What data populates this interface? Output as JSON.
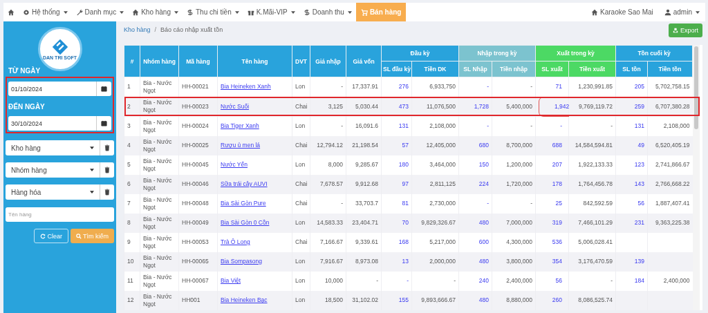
{
  "navbar": {
    "items": [
      {
        "selected": false,
        "caret": false
      },
      {
        "label": "Hệ thống",
        "selected": false,
        "caret": true
      },
      {
        "label": "Danh mục",
        "selected": false,
        "caret": true
      },
      {
        "label": "Kho hàng",
        "selected": false,
        "caret": true
      },
      {
        "label": "Thu chi tiền",
        "selected": false,
        "caret": true
      },
      {
        "label": "K.Mãi-VIP",
        "selected": false,
        "caret": true
      },
      {
        "label": "Doanh thu",
        "selected": false,
        "caret": true
      },
      {
        "label": "Bán hàng",
        "selected": true,
        "caret": false
      }
    ],
    "right": [
      {
        "label": "Karaoke Sao Mai",
        "caret": false
      },
      {
        "label": "admin",
        "caret": true
      }
    ]
  },
  "sidebar": {
    "logo_text": "DAN TRI SOFT",
    "dates_highlighted": true,
    "from_label": "TỪ NGÀY",
    "from_value": "01/10/2024",
    "to_label": "ĐẾN NGÀY",
    "to_value": "30/10/2024",
    "selects": [
      "Kho hàng",
      "Nhóm hàng",
      "Hàng hóa"
    ],
    "name_placeholder": "Tên hàng",
    "clear_button": "Clear",
    "search_button": "Tìm kiếm"
  },
  "breadcrumb": [
    "Kho hàng",
    "Báo cáo nhập xuất tồn"
  ],
  "breadcrumb_separator": "/",
  "export_button": "Export",
  "table": {
    "head": [
      {
        "label": "#",
        "kind": "index"
      },
      {
        "label": "Nhóm hàng",
        "kind": "text"
      },
      {
        "label": "Mã hàng",
        "kind": "text"
      },
      {
        "label": "Tên hàng",
        "kind": "link"
      },
      {
        "label": "DVT",
        "kind": "text"
      },
      {
        "label": "Giá nhập",
        "kind": "amount"
      },
      {
        "label": "Giá vốn",
        "kind": "amount"
      },
      {
        "group": "Đầu kỳ",
        "color": "#29a3dc",
        "columns": [
          {
            "label": "SL đầu kỳ",
            "kind": "count"
          },
          {
            "label": "Tiền DK",
            "kind": "amount"
          }
        ]
      },
      {
        "group": "Nhập trong kỳ",
        "color": "#7cc3cf",
        "columns": [
          {
            "label": "SL Nhập",
            "kind": "count"
          },
          {
            "label": "Tiền nhập",
            "kind": "amount"
          }
        ]
      },
      {
        "group": "Xuất trong kỳ",
        "color": "#4cd964",
        "columns": [
          {
            "label": "SL xuất",
            "kind": "count"
          },
          {
            "label": "Tiền xuất",
            "kind": "amount"
          }
        ]
      },
      {
        "group": "Tồn cuối kỳ",
        "color": "#29a3dc",
        "columns": [
          {
            "label": "SL tồn",
            "kind": "count"
          },
          {
            "label": "Tiền tồn",
            "kind": "amount"
          }
        ]
      }
    ],
    "rows": [
      {
        "highlighted": false,
        "circled": false,
        "cells": [
          "1",
          "Bia - Nước Ngọt",
          "HH-00021",
          "Bia Heineken Xanh",
          "Lon",
          "-",
          "17,337.91",
          "276",
          "6,933,750",
          "-",
          "-",
          "71",
          "1,230,991.85",
          "205",
          "5,702,758.15"
        ]
      },
      {
        "highlighted": true,
        "circled": true,
        "cells": [
          "2",
          "Bia - Nước Ngọt",
          "HH-00023",
          "Nước Suối",
          "Chai",
          "3,125",
          "5,030.44",
          "473",
          "11,076,500",
          "1,728",
          "5,400,000",
          "1,942",
          "9,769,119.72",
          "259",
          "6,707,380.28"
        ]
      },
      {
        "highlighted": false,
        "circled": false,
        "cells": [
          "3",
          "Bia - Nước Ngọt",
          "HH-00024",
          "Bia Tiger Xanh",
          "Lon",
          "-",
          "16,091.6",
          "131",
          "2,108,000",
          "-",
          "-",
          "-",
          "-",
          "131",
          "2,108,000"
        ]
      },
      {
        "highlighted": false,
        "circled": false,
        "cells": [
          "4",
          "Bia - Nước Ngọt",
          "HH-00025",
          "Rượu ủ men lá",
          "Chai",
          "12,794.12",
          "21,198.54",
          "57",
          "12,405,000",
          "680",
          "8,700,000",
          "688",
          "14,584,594.81",
          "49",
          "6,520,405.19"
        ]
      },
      {
        "highlighted": false,
        "circled": false,
        "cells": [
          "5",
          "Bia - Nước Ngọt",
          "HH-00045",
          "Nước Yến",
          "Lon",
          "8,000",
          "9,285.67",
          "180",
          "3,464,000",
          "150",
          "1,200,000",
          "207",
          "1,922,133.33",
          "123",
          "2,741,866.67"
        ]
      },
      {
        "highlighted": false,
        "circled": false,
        "cells": [
          "6",
          "Bia - Nước Ngọt",
          "HH-00046",
          "Sữa trái cây AUVI",
          "Chai",
          "7,678.57",
          "9,912.68",
          "97",
          "2,811,125",
          "224",
          "1,720,000",
          "178",
          "1,764,456.78",
          "143",
          "2,766,668.22"
        ]
      },
      {
        "highlighted": false,
        "circled": false,
        "cells": [
          "7",
          "Bia - Nước Ngọt",
          "HH-00048",
          "Bia Sài Gòn Pure",
          "Chai",
          "-",
          "33,703.7",
          "81",
          "2,730,000",
          "-",
          "-",
          "25",
          "842,592.59",
          "56",
          "1,887,407.41"
        ]
      },
      {
        "highlighted": false,
        "circled": false,
        "cells": [
          "8",
          "Bia - Nước Ngọt",
          "HH-00049",
          "Bia Sài Gòn 0 Cồn",
          "Lon",
          "14,583.33",
          "23,404.71",
          "70",
          "9,829,326.67",
          "480",
          "7,000,000",
          "319",
          "7,466,101.29",
          "231",
          "9,363,225.38"
        ]
      },
      {
        "highlighted": false,
        "circled": false,
        "cells": [
          "9",
          "Bia - Nước Ngọt",
          "HH-00053",
          "Trà Ô Long",
          "Chai",
          "7,166.67",
          "9,339.61",
          "168",
          "5,217,000",
          "600",
          "4,300,000",
          "536",
          "5,006,028.41",
          null,
          null
        ]
      },
      {
        "highlighted": false,
        "circled": false,
        "cells": [
          "10",
          "Bia - Nước Ngọt",
          "HH-00065",
          "Bia Sompasong",
          "Lon",
          "7,916.67",
          "8,973.08",
          "13",
          "2,000,000",
          "480",
          "3,800,000",
          "354",
          "3,176,470.59",
          "139",
          null
        ]
      },
      {
        "highlighted": false,
        "circled": false,
        "cells": [
          "11",
          "Bia - Nước Ngọt",
          "HH-00067",
          "Bia Việt",
          "Lon",
          "10,000",
          "-",
          "-",
          "-",
          "240",
          "2,400,000",
          "56",
          "-",
          "184",
          "2,400,000"
        ]
      },
      {
        "highlighted": false,
        "circled": false,
        "cells": [
          "12",
          "Bia - Nước Ngọt",
          "HH001",
          "Bia Heineken Bạc",
          "Lon",
          "18,500",
          "31,102.02",
          "155",
          "9,893,666.67",
          "480",
          "8,880,000",
          "260",
          "8,086,525.74",
          null,
          null
        ]
      }
    ]
  }
}
